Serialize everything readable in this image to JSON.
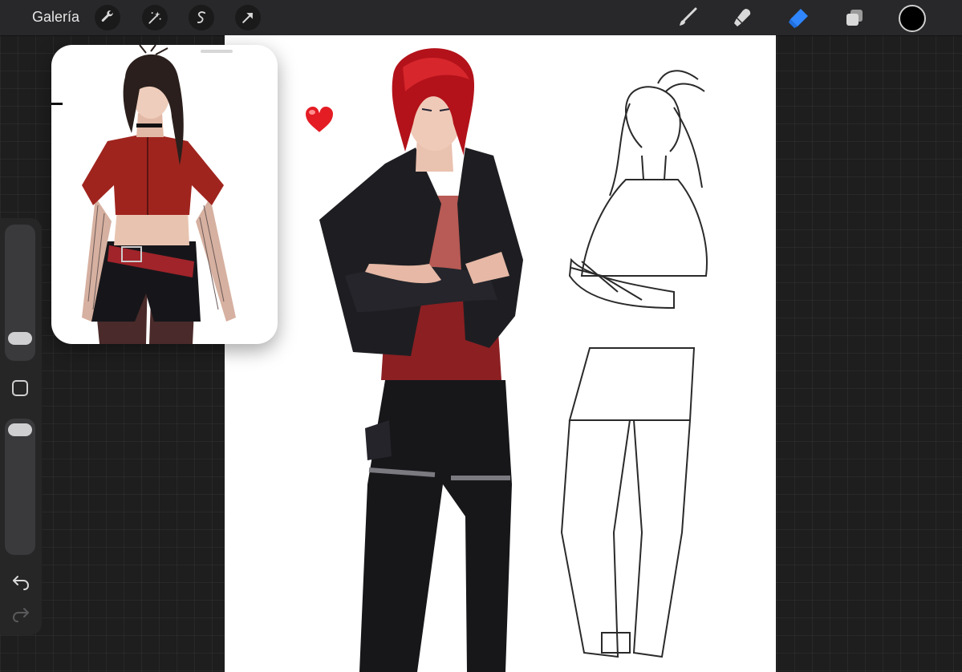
{
  "toolbar": {
    "gallery_label": "Galería",
    "left_tools": [
      "wrench-icon",
      "magic-wand-icon",
      "selection-icon",
      "move-arrow-icon"
    ],
    "right_tools": [
      "brush-icon",
      "smudge-icon",
      "eraser-icon",
      "layers-icon"
    ],
    "active_tool": "eraser",
    "active_color": "#000000",
    "accent_color": "#2f86ff"
  },
  "sidebar": {
    "brush_size": 0.25,
    "opacity": 0.95,
    "controls": [
      "brush-size-slider",
      "modify-button",
      "opacity-slider",
      "undo-icon",
      "redo-icon"
    ]
  },
  "canvas": {
    "background": "#ffffff"
  }
}
